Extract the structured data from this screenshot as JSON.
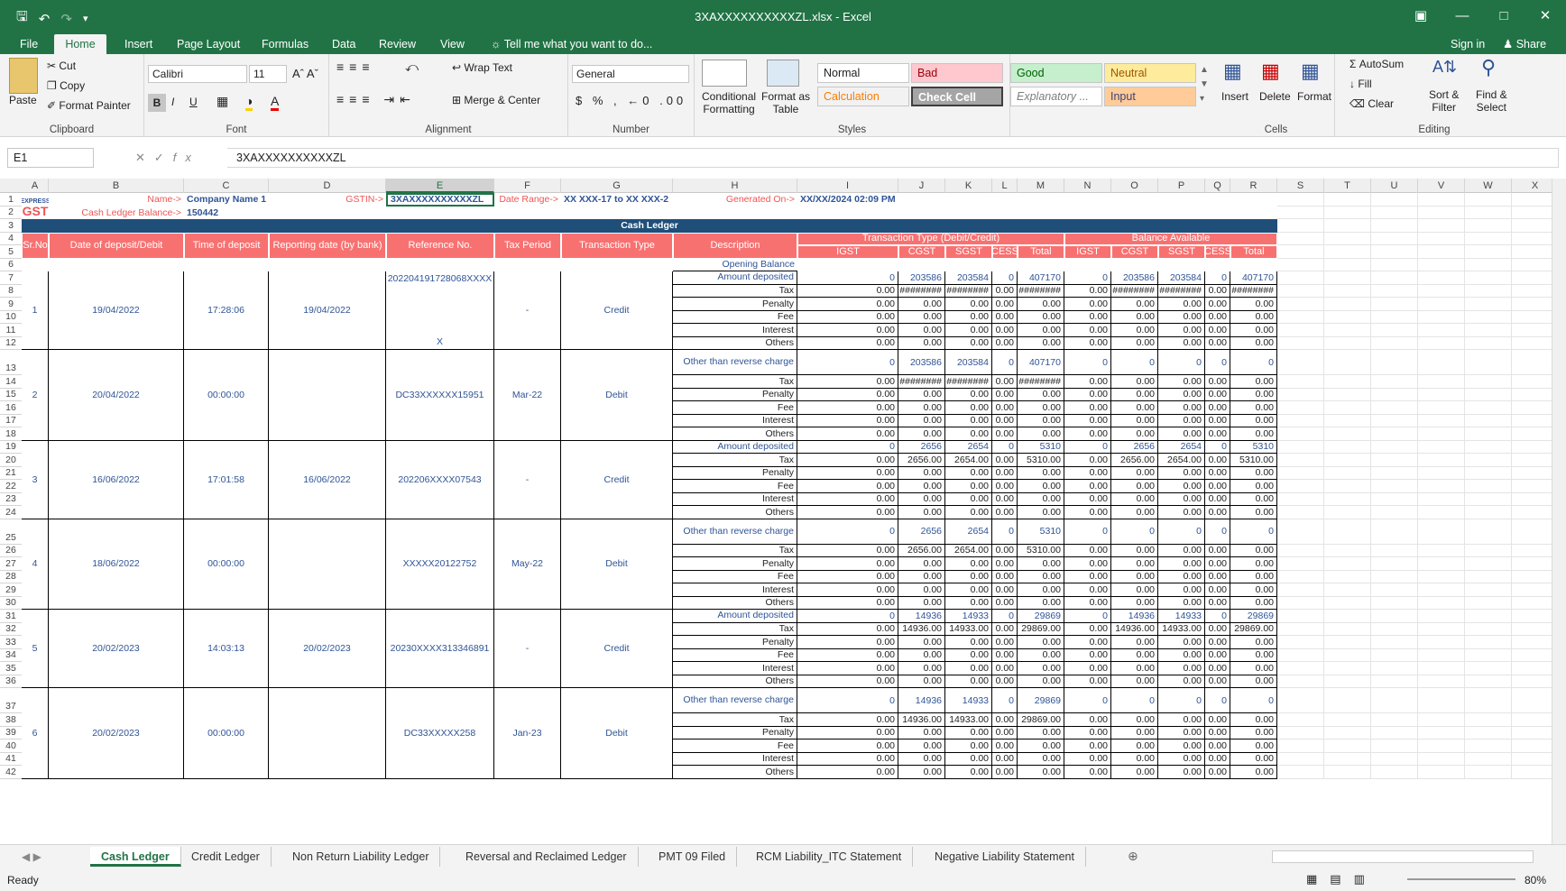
{
  "window": {
    "title": "3XAXXXXXXXXXXZL.xlsx - Excel"
  },
  "ribbon_tabs": [
    "File",
    "Home",
    "Insert",
    "Page Layout",
    "Formulas",
    "Data",
    "Review",
    "View"
  ],
  "tell_me": "Tell me what you want to do...",
  "account": {
    "signin": "Sign in",
    "share": "Share"
  },
  "clipboard": {
    "paste": "Paste",
    "cut": "Cut",
    "copy": "Copy",
    "painter": "Format Painter",
    "label": "Clipboard"
  },
  "font": {
    "name": "Calibri",
    "size": "11",
    "label": "Font"
  },
  "alignment": {
    "wrap": "Wrap Text",
    "merge": "Merge & Center",
    "label": "Alignment"
  },
  "number": {
    "format": "General",
    "label": "Number"
  },
  "styles": {
    "cond1": "Conditional",
    "cond2": "Formatting",
    "fmt1": "Format as",
    "fmt2": "Table",
    "label": "Styles",
    "cells": [
      "Normal",
      "Bad",
      "Good",
      "Neutral",
      "Calculation",
      "Check Cell",
      "Explanatory ...",
      "Input"
    ]
  },
  "cells_group": {
    "insert": "Insert",
    "delete": "Delete",
    "format": "Format",
    "label": "Cells"
  },
  "editing": {
    "autosum": "AutoSum",
    "fill": "Fill",
    "clear": "Clear",
    "sort1": "Sort &",
    "sort2": "Filter",
    "find1": "Find &",
    "find2": "Select",
    "label": "Editing"
  },
  "formula_bar": {
    "name_box": "E1",
    "value": "3XAXXXXXXXXXXZL"
  },
  "columns": [
    "A",
    "B",
    "C",
    "D",
    "E",
    "F",
    "G",
    "H",
    "I",
    "J",
    "K",
    "L",
    "M",
    "N",
    "O",
    "P",
    "Q",
    "R",
    "S",
    "T",
    "U",
    "V",
    "W",
    "X"
  ],
  "sheet": {
    "logo_top": "EXPRESS",
    "logo_bottom": "GST",
    "name_label": "Name->",
    "name_value": "Company Name 1",
    "gstin_label": "GSTIN->",
    "gstin_value": "3XAXXXXXXXXXXZL",
    "date_range_label": "Date Range->",
    "date_range_value": "XX XXX-17 to XX XXX-2",
    "generated_label": "Generated On->",
    "generated_value": "XX/XX/2024 02:09 PM",
    "balance_label": "Cash Ledger Balance->",
    "balance_value": "150442",
    "banner": "Cash Ledger",
    "headers": {
      "srno": "Sr.No",
      "date": "Date  of deposit/Debit",
      "time": "Time of deposit",
      "reporting": "Reporting date (by bank)",
      "ref": "Reference No.",
      "tax_period": "Tax Period",
      "type": "Transaction Type",
      "desc": "Description",
      "txn_group": "Transaction Type (Debit/Credit)",
      "bal_group": "Balance Available",
      "sub": [
        "IGST",
        "CGST",
        "SGST",
        "CESS",
        "Total",
        "IGST",
        "CGST",
        "SGST",
        "CESS",
        "Total"
      ]
    },
    "opening_balance": "Opening Balance",
    "records": [
      {
        "sr": "1",
        "date": "19/04/2022",
        "time": "17:28:06",
        "reporting": "19/04/2022",
        "ref": "202204191728068XXXX",
        "ref2": "X",
        "period": "-",
        "type": "Credit",
        "first": "Amount deposited",
        "vals": [
          "0",
          "203586",
          "203584",
          "0",
          "407170",
          "0",
          "203586",
          "203584",
          "0",
          "407170"
        ],
        "tax": [
          "0.00",
          "########",
          "########",
          "0.00",
          "########",
          "0.00",
          "########",
          "########",
          "0.00",
          "########"
        ]
      },
      {
        "sr": "2",
        "date": "20/04/2022",
        "time": "00:00:00",
        "reporting": "",
        "ref": "DC33XXXXXX15951",
        "ref2": "",
        "period": "Mar-22",
        "type": "Debit",
        "first": "Other than reverse charge",
        "vals": [
          "0",
          "203586",
          "203584",
          "0",
          "407170",
          "0",
          "0",
          "0",
          "0",
          "0"
        ],
        "tax": [
          "0.00",
          "########",
          "########",
          "0.00",
          "########",
          "0.00",
          "0.00",
          "0.00",
          "0.00",
          "0.00"
        ]
      },
      {
        "sr": "3",
        "date": "16/06/2022",
        "time": "17:01:58",
        "reporting": "16/06/2022",
        "ref": "202206XXXX07543",
        "ref2": "",
        "period": "-",
        "type": "Credit",
        "first": "Amount deposited",
        "vals": [
          "0",
          "2656",
          "2654",
          "0",
          "5310",
          "0",
          "2656",
          "2654",
          "0",
          "5310"
        ],
        "tax": [
          "0.00",
          "2656.00",
          "2654.00",
          "0.00",
          "5310.00",
          "0.00",
          "2656.00",
          "2654.00",
          "0.00",
          "5310.00"
        ]
      },
      {
        "sr": "4",
        "date": "18/06/2022",
        "time": "00:00:00",
        "reporting": "",
        "ref": "XXXXX20122752",
        "ref2": "",
        "period": "May-22",
        "type": "Debit",
        "first": "Other than reverse charge",
        "vals": [
          "0",
          "2656",
          "2654",
          "0",
          "5310",
          "0",
          "0",
          "0",
          "0",
          "0"
        ],
        "tax": [
          "0.00",
          "2656.00",
          "2654.00",
          "0.00",
          "5310.00",
          "0.00",
          "0.00",
          "0.00",
          "0.00",
          "0.00"
        ]
      },
      {
        "sr": "5",
        "date": "20/02/2023",
        "time": "14:03:13",
        "reporting": "20/02/2023",
        "ref": "20230XXXX313346891",
        "ref2": "",
        "period": "-",
        "type": "Credit",
        "first": "Amount deposited",
        "vals": [
          "0",
          "14936",
          "14933",
          "0",
          "29869",
          "0",
          "14936",
          "14933",
          "0",
          "29869"
        ],
        "tax": [
          "0.00",
          "14936.00",
          "14933.00",
          "0.00",
          "29869.00",
          "0.00",
          "14936.00",
          "14933.00",
          "0.00",
          "29869.00"
        ]
      },
      {
        "sr": "6",
        "date": "20/02/2023",
        "time": "00:00:00",
        "reporting": "",
        "ref": "DC33XXXXX258",
        "ref2": "",
        "period": "Jan-23",
        "type": "Debit",
        "first": "Other than reverse charge",
        "vals": [
          "0",
          "14936",
          "14933",
          "0",
          "29869",
          "0",
          "0",
          "0",
          "0",
          "0"
        ],
        "tax": [
          "0.00",
          "14936.00",
          "14933.00",
          "0.00",
          "29869.00",
          "0.00",
          "0.00",
          "0.00",
          "0.00",
          "0.00"
        ]
      }
    ],
    "sub_labels": [
      "Tax",
      "Penalty",
      "Fee",
      "Interest",
      "Others"
    ],
    "zero": "0.00"
  },
  "sheet_tabs": [
    "Cash Ledger",
    "Credit Ledger",
    "Non Return Liability Ledger",
    "Reversal and Reclaimed Ledger",
    "PMT 09 Filed",
    "RCM Liability_ITC Statement",
    "Negative Liability Statement"
  ],
  "status": {
    "ready": "Ready",
    "zoom": "80%"
  }
}
